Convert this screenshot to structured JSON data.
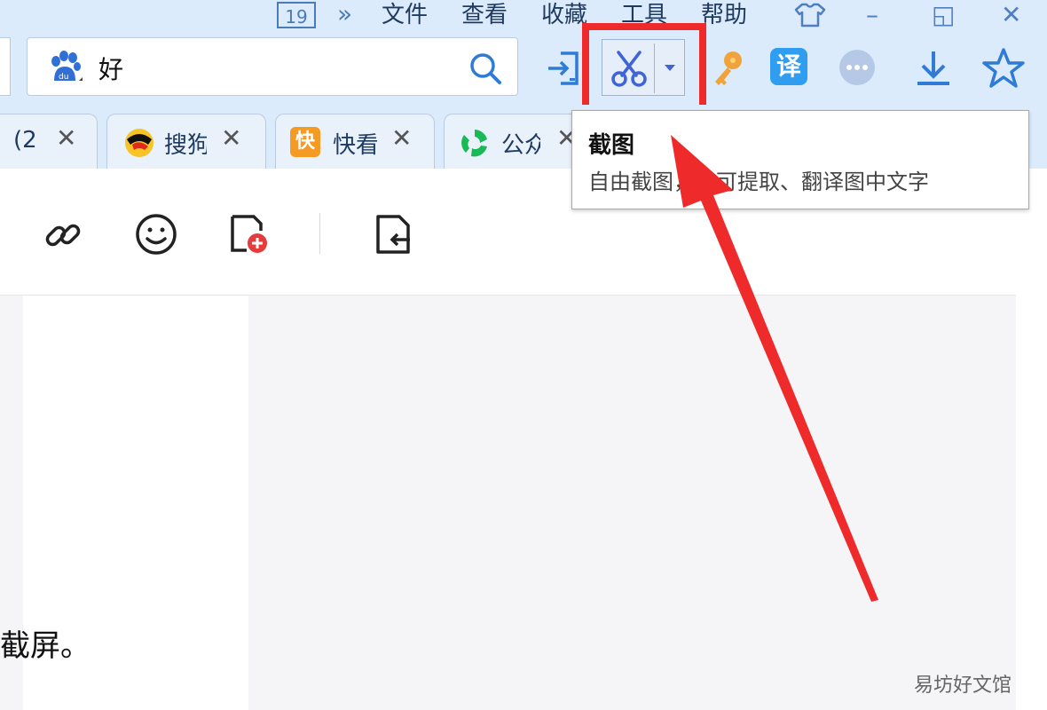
{
  "menu": {
    "day": "19",
    "more": "»",
    "items": [
      "文件",
      "查看",
      "收藏",
      "工具",
      "帮助"
    ]
  },
  "window_controls": {
    "skin": "skin-icon",
    "minimize": "–",
    "restore": "◱",
    "close": "✕"
  },
  "search": {
    "engine_icon": "baidu-paw-icon",
    "value": "好"
  },
  "toolbar_icons": [
    "login-icon",
    "scissors-icon",
    "key-icon",
    "translate-icon",
    "more-icon",
    "download-icon",
    "star-icon"
  ],
  "translate_glyph": "译",
  "tabs": [
    {
      "label": "(2",
      "icon": "none"
    },
    {
      "label": "搜狗",
      "icon": "sogou-icon"
    },
    {
      "label": "快看",
      "icon": "kuai-icon"
    },
    {
      "label": "公众",
      "icon": "wechat-public-icon"
    }
  ],
  "tab_badge_glyph": "快",
  "tooltip": {
    "title": "截图",
    "description": "自由截图，并可提取、翻译图中文字"
  },
  "editor_icons": [
    "link-icon",
    "emoji-icon",
    "add-image-icon",
    "import-doc-icon"
  ],
  "body_text": "截屏。",
  "watermark": "易坊好文馆",
  "colors": {
    "highlight": "#ee2a2a",
    "accent": "#2f7bd6",
    "chrome": "#dcebfb"
  }
}
